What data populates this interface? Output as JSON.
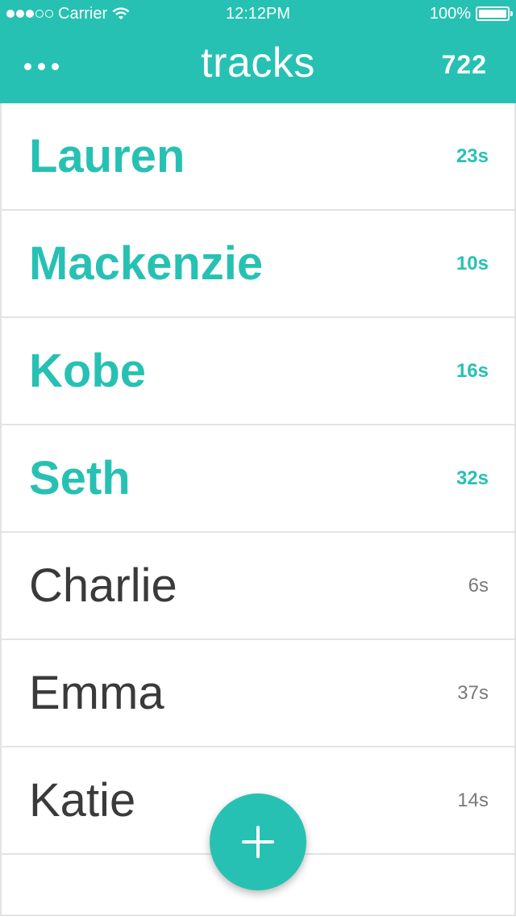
{
  "status_bar": {
    "carrier": "Carrier",
    "time": "12:12PM",
    "battery": "100%",
    "signal_icon": "signal-dots-icon",
    "wifi_icon": "wifi-icon",
    "battery_icon": "battery-icon"
  },
  "nav": {
    "title": "tracks",
    "count": "722",
    "menu_icon": "more-dots-icon"
  },
  "tracks": [
    {
      "name": "Lauren",
      "duration": "23s",
      "state": "active"
    },
    {
      "name": "Mackenzie",
      "duration": "10s",
      "state": "active"
    },
    {
      "name": "Kobe",
      "duration": "16s",
      "state": "active"
    },
    {
      "name": "Seth",
      "duration": "32s",
      "state": "active"
    },
    {
      "name": "Charlie",
      "duration": "6s",
      "state": "inactive"
    },
    {
      "name": "Emma",
      "duration": "37s",
      "state": "inactive"
    },
    {
      "name": "Katie",
      "duration": "14s",
      "state": "inactive"
    }
  ],
  "fab": {
    "icon": "plus-icon"
  },
  "colors": {
    "accent": "#27C1B3",
    "text_dark": "#3a3a3a",
    "text_muted": "#7a7a7a",
    "divider": "#e3e3e3"
  }
}
